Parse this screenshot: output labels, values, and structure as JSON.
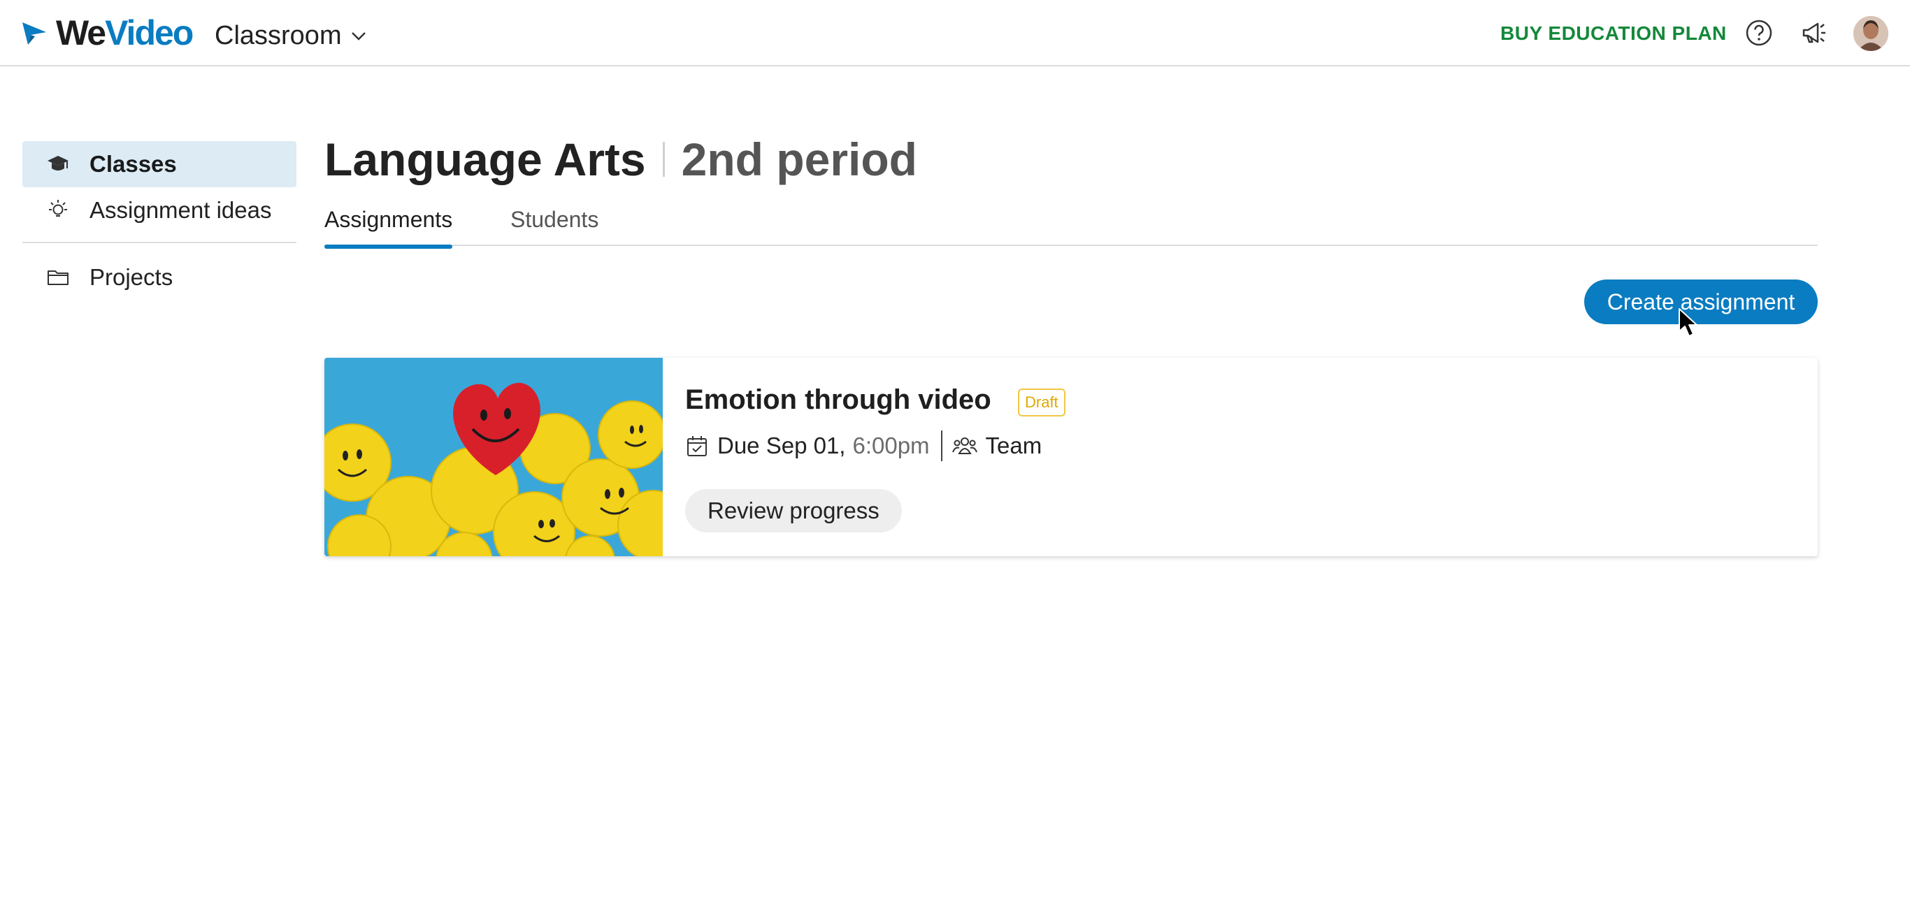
{
  "header": {
    "logo_text": "WeVideo",
    "product_label": "Classroom",
    "buy_plan_label": "BUY EDUCATION PLAN",
    "icons": [
      "help-icon",
      "announcement-icon"
    ],
    "accent_color": "#0a7cc1",
    "buy_color": "#13883a"
  },
  "sidebar": {
    "items": [
      {
        "label": "Classes",
        "icon": "graduation-cap-icon",
        "active": true
      },
      {
        "label": "Assignment ideas",
        "icon": "lightbulb-icon",
        "active": false
      },
      {
        "label": "Projects",
        "icon": "folder-icon",
        "active": false
      }
    ]
  },
  "main": {
    "title": "Language Arts",
    "subtitle": "2nd period",
    "tabs": [
      {
        "label": "Assignments",
        "active": true
      },
      {
        "label": "Students",
        "active": false
      }
    ],
    "create_label": "Create assignment",
    "assignment": {
      "title": "Emotion through video",
      "status": "Draft",
      "due_label": "Due Sep 01,",
      "due_time": "6:00pm",
      "group_type": "Team",
      "review_label": "Review progress"
    }
  }
}
